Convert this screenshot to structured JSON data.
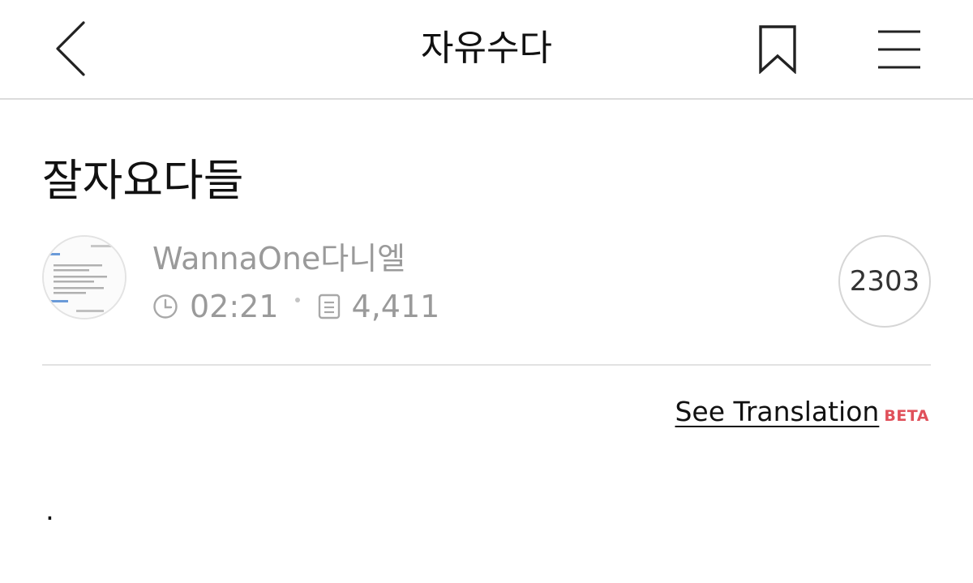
{
  "header": {
    "title": "자유수다"
  },
  "post": {
    "title": "잘자요다들",
    "author": "WannaOne다니엘",
    "time": "02:21",
    "views": "4,411",
    "comment_count": "2303",
    "body": "."
  },
  "translation": {
    "link_label": "See Translation",
    "badge": "BETA"
  },
  "icons": {
    "back": "chevron-left-icon",
    "bookmark": "bookmark-icon",
    "menu": "hamburger-menu-icon",
    "clock": "clock-icon",
    "views": "document-icon"
  },
  "colors": {
    "meta_gray": "#9a9a9a",
    "beta_red": "#e0505a",
    "divider": "#e2e2e2"
  }
}
